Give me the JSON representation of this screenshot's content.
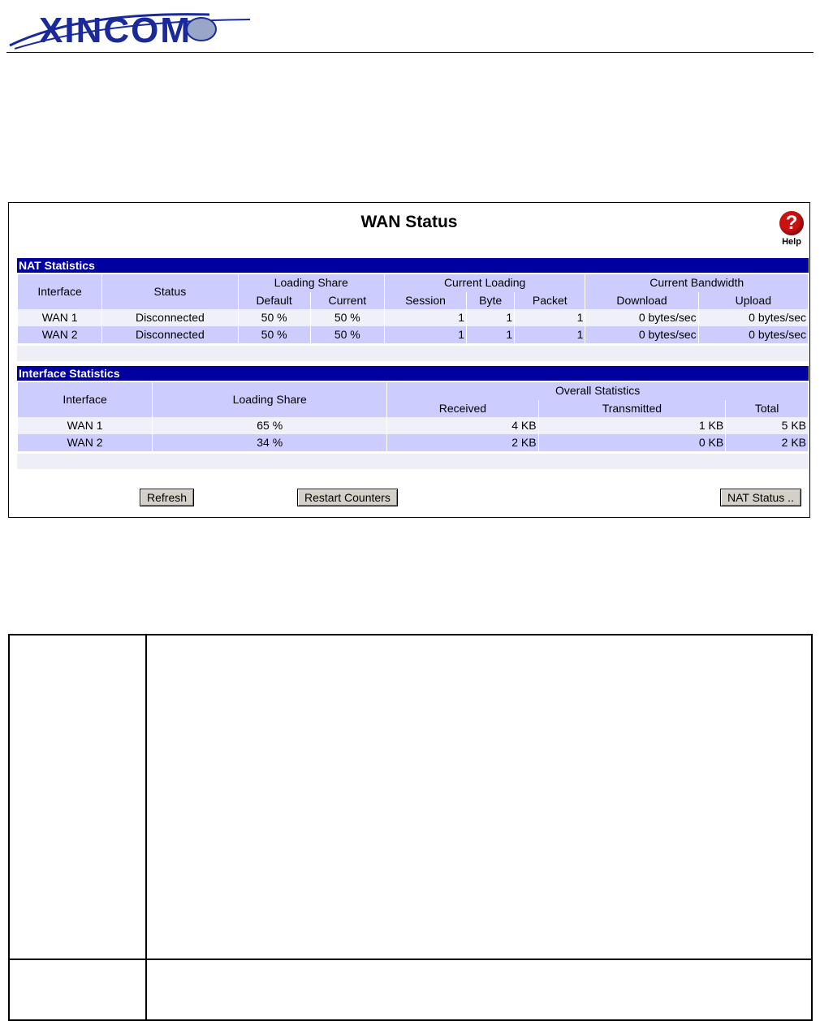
{
  "header": {
    "logo_text": "XINCOM"
  },
  "panel": {
    "title": "WAN Status",
    "help_label": "Help",
    "help_glyph": "?"
  },
  "nat": {
    "section_title": "NAT Statistics",
    "headers": {
      "interface": "Interface",
      "status": "Status",
      "loading_share": "Loading Share",
      "current_loading": "Current Loading",
      "current_bandwidth": "Current Bandwidth",
      "default": "Default",
      "current": "Current",
      "session": "Session",
      "byte": "Byte",
      "packet": "Packet",
      "download": "Download",
      "upload": "Upload"
    },
    "rows": [
      {
        "interface": "WAN 1",
        "status": "Disconnected",
        "default": "50 %",
        "current": "50 %",
        "session": "1",
        "byte": "1",
        "packet": "1",
        "download": "0 bytes/sec",
        "upload": "0 bytes/sec"
      },
      {
        "interface": "WAN 2",
        "status": "Disconnected",
        "default": "50 %",
        "current": "50 %",
        "session": "1",
        "byte": "1",
        "packet": "1",
        "download": "0 bytes/sec",
        "upload": "0 bytes/sec"
      }
    ]
  },
  "iface": {
    "section_title": "Interface Statistics",
    "headers": {
      "interface": "Interface",
      "loading_share": "Loading Share",
      "overall": "Overall Statistics",
      "received": "Received",
      "transmitted": "Transmitted",
      "total": "Total"
    },
    "rows": [
      {
        "interface": "WAN 1",
        "loading_share": "65 %",
        "received": "4 KB",
        "transmitted": "1 KB",
        "total": "5 KB"
      },
      {
        "interface": "WAN 2",
        "loading_share": "34 %",
        "received": "2 KB",
        "transmitted": "0 KB",
        "total": "2 KB"
      }
    ]
  },
  "buttons": {
    "refresh": "Refresh",
    "restart": "Restart Counters",
    "nat_status": "NAT Status .."
  },
  "colors": {
    "section_bar": "#0000a0",
    "header_cell": "#ccccff",
    "help_red": "#cc1111"
  }
}
